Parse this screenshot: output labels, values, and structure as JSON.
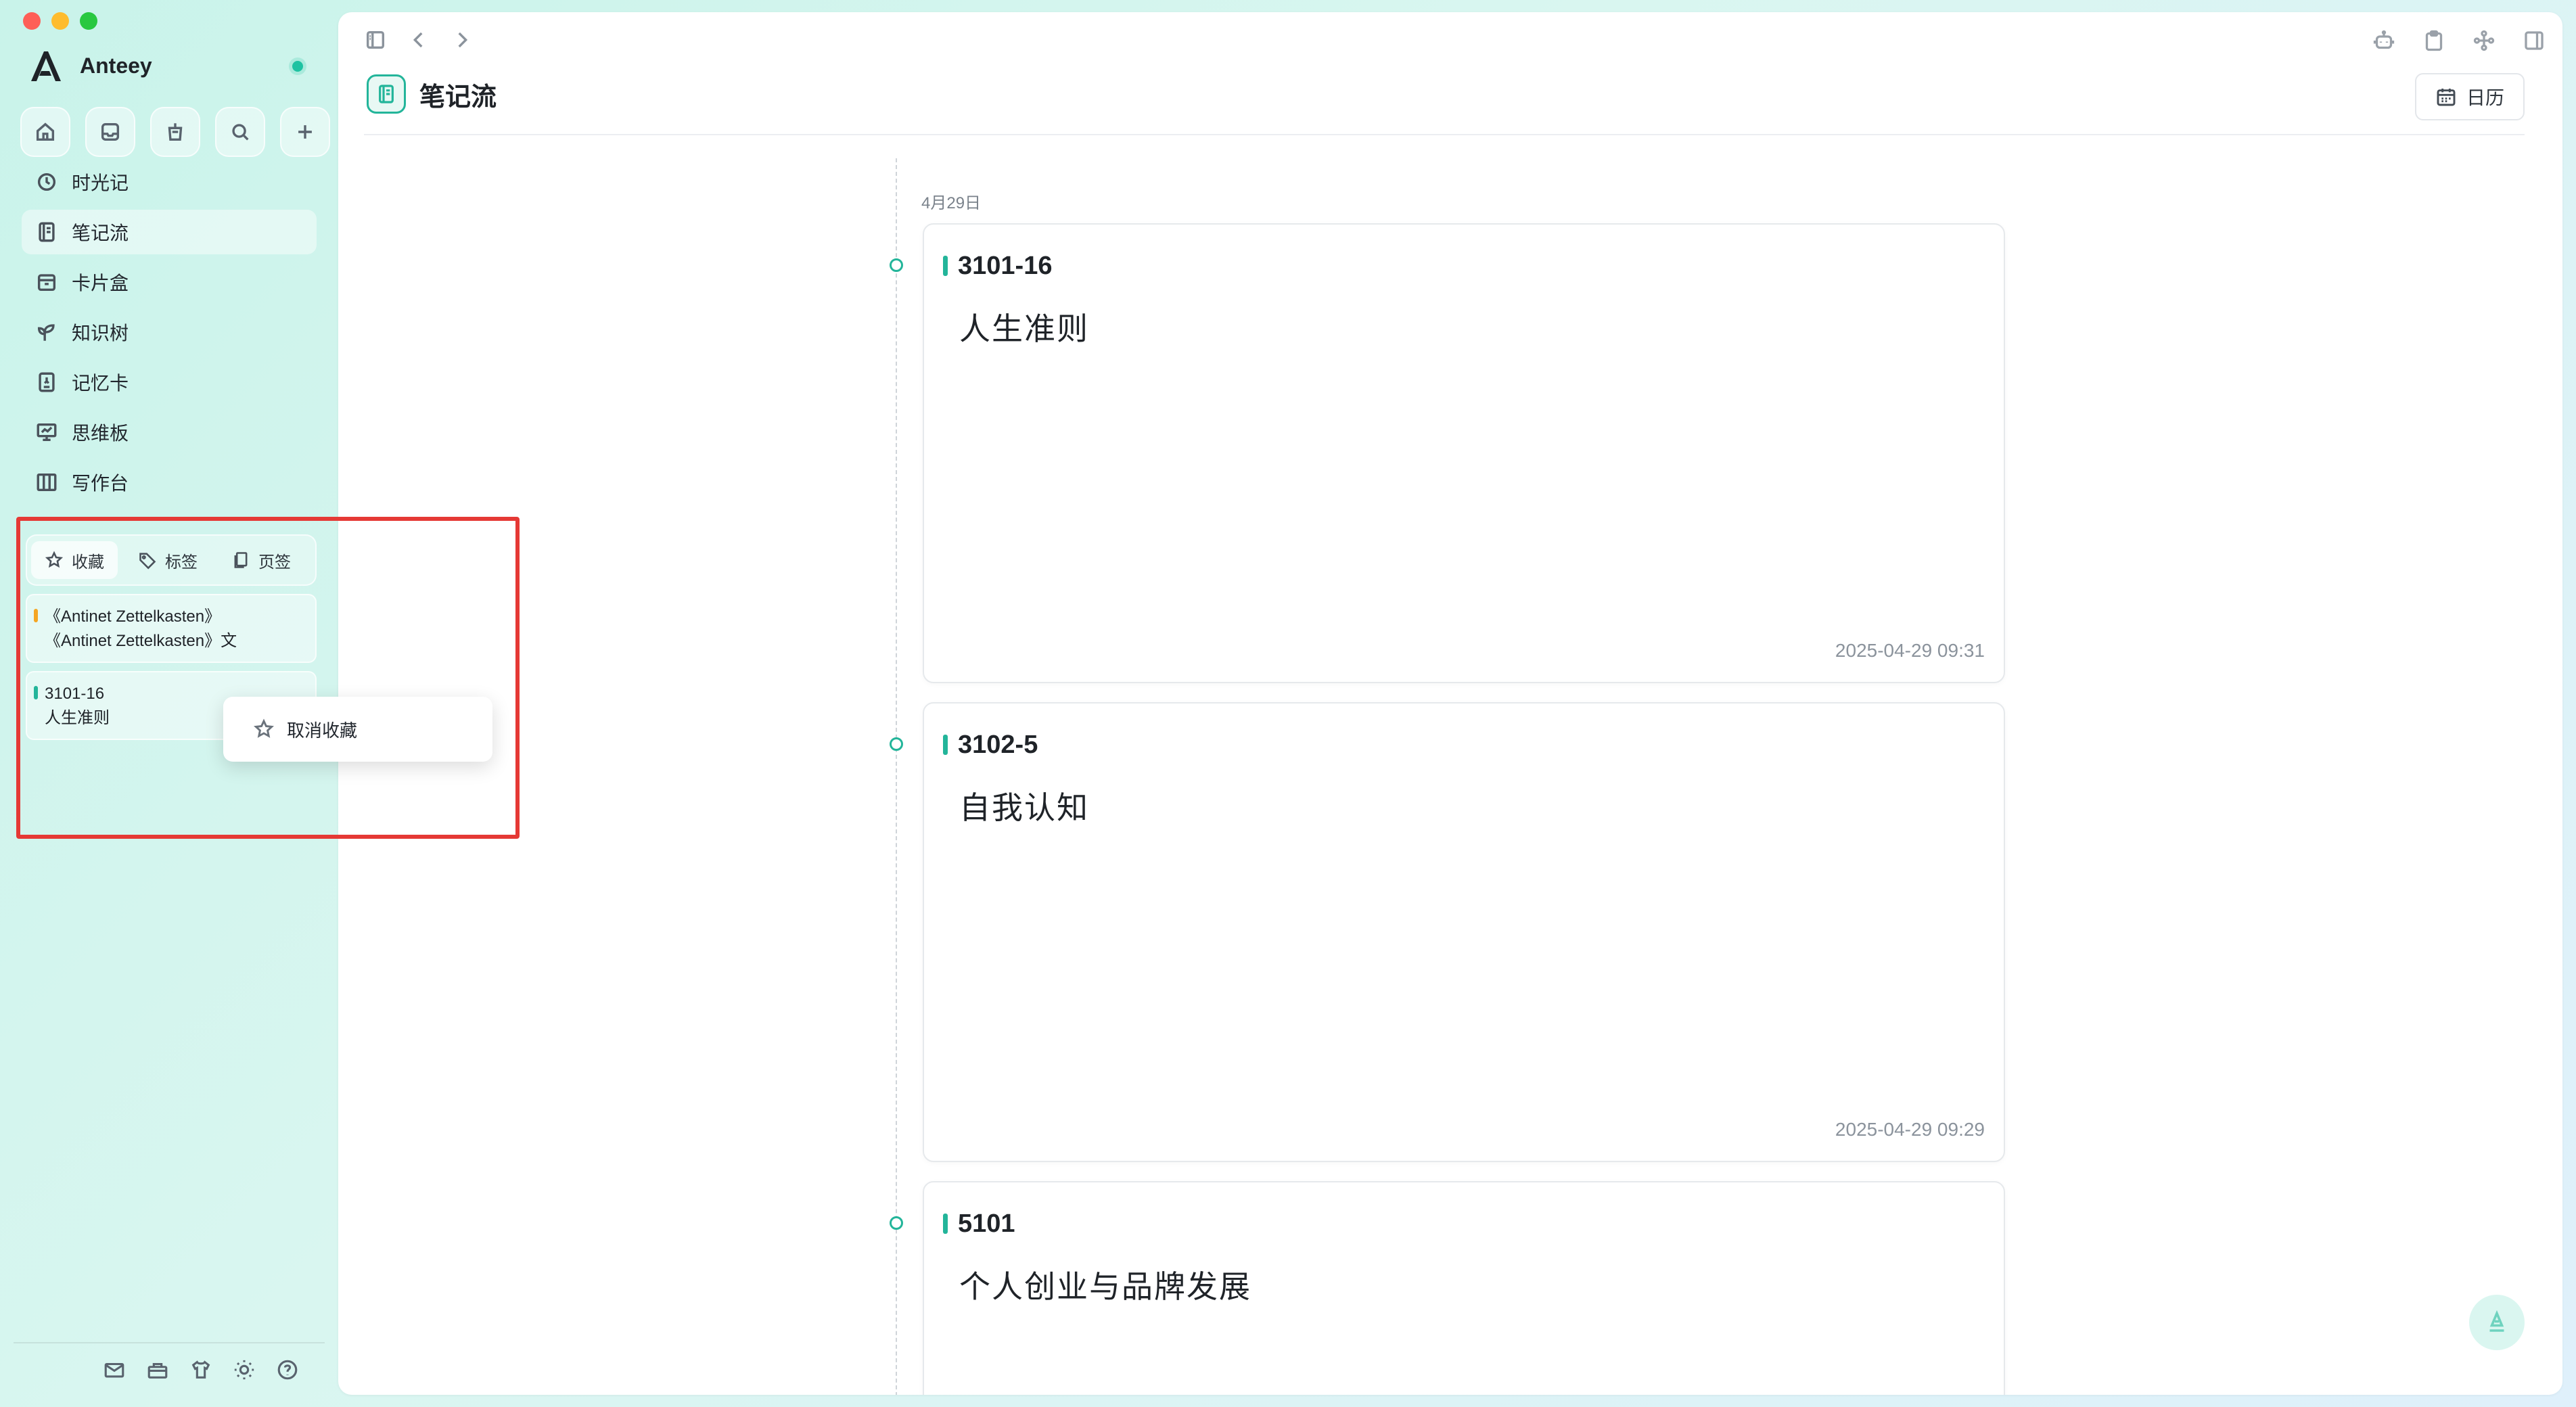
{
  "app": {
    "name": "Anteey",
    "status": "online"
  },
  "quick_actions": [
    "home-icon",
    "inbox-icon",
    "drink-icon",
    "search-icon",
    "plus-icon"
  ],
  "nav": {
    "items": [
      {
        "label": "时光记",
        "icon": "clock-icon",
        "active": false
      },
      {
        "label": "笔记流",
        "icon": "notebook-icon",
        "active": true
      },
      {
        "label": "卡片盒",
        "icon": "card-box-icon",
        "active": false
      },
      {
        "label": "知识树",
        "icon": "sprout-icon",
        "active": false
      },
      {
        "label": "记忆卡",
        "icon": "memory-card-icon",
        "active": false
      },
      {
        "label": "思维板",
        "icon": "whiteboard-icon",
        "active": false
      },
      {
        "label": "写作台",
        "icon": "writing-desk-icon",
        "active": false
      }
    ]
  },
  "favorites": {
    "tabs": [
      {
        "label": "收藏",
        "icon": "star-icon",
        "active": true
      },
      {
        "label": "标签",
        "icon": "tag-icon",
        "active": false
      },
      {
        "label": "页签",
        "icon": "pages-icon",
        "active": false
      }
    ],
    "items": [
      {
        "line1": "《Antinet Zettelkasten》",
        "line2": "《Antinet Zettelkasten》文",
        "color": "#f5a623"
      },
      {
        "line1": "3101-16",
        "line2": "人生准则",
        "color": "#23b59a"
      }
    ]
  },
  "context_menu": {
    "label": "取消收藏",
    "icon": "star-icon"
  },
  "bottom_icons": [
    "mail-icon",
    "toolbox-icon",
    "shirt-icon",
    "sun-icon",
    "help-icon"
  ],
  "main": {
    "title": "笔记流",
    "calendar_label": "日历",
    "date_group": "4月29日",
    "notes": [
      {
        "id": "3101-16",
        "body": "人生准则",
        "time": "2025-04-29 09:31"
      },
      {
        "id": "3102-5",
        "body": "自我认知",
        "time": "2025-04-29 09:29"
      },
      {
        "id": "5101",
        "body": "个人创业与品牌发展",
        "time": ""
      }
    ]
  },
  "colors": {
    "accent": "#23b59a",
    "highlight_box": "#e53935"
  }
}
